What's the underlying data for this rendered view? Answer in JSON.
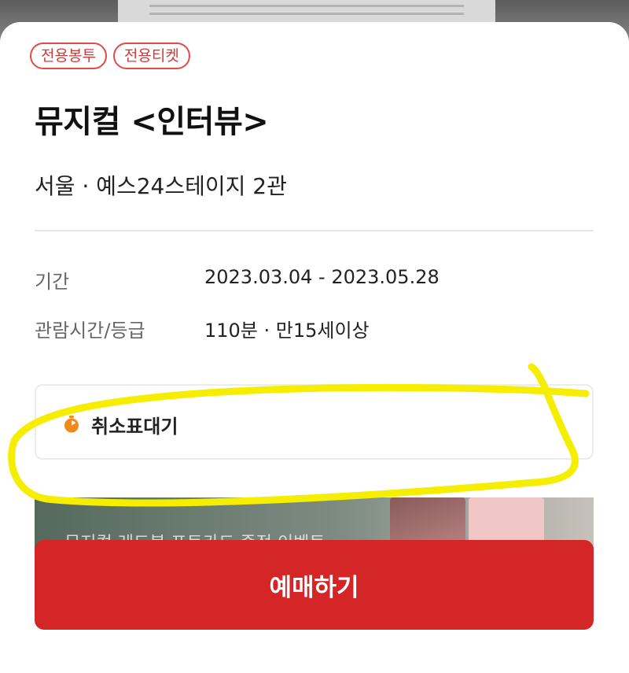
{
  "badges": [
    "전용봉투",
    "전용티켓"
  ],
  "show": {
    "title": "뮤지컬 <인터뷰>",
    "venue": "서울 · 예스24스테이지 2관"
  },
  "info": {
    "period_label": "기간",
    "period_value": "2023.03.04 - 2023.05.28",
    "runtime_label": "관람시간/등급",
    "runtime_value": "110분 · 만15세이상"
  },
  "wait": {
    "label": "취소표대기",
    "icon": "timer-icon",
    "chevron": "chevron-right-icon"
  },
  "banner": {
    "text": "뮤지컬 레드북 포토카드 증정 이벤트"
  },
  "book_button": "예매하기",
  "colors": {
    "accent": "#d42626",
    "badge_border": "#e04a4a",
    "timer": "#f08a1c",
    "highlight": "#f5ee00"
  }
}
